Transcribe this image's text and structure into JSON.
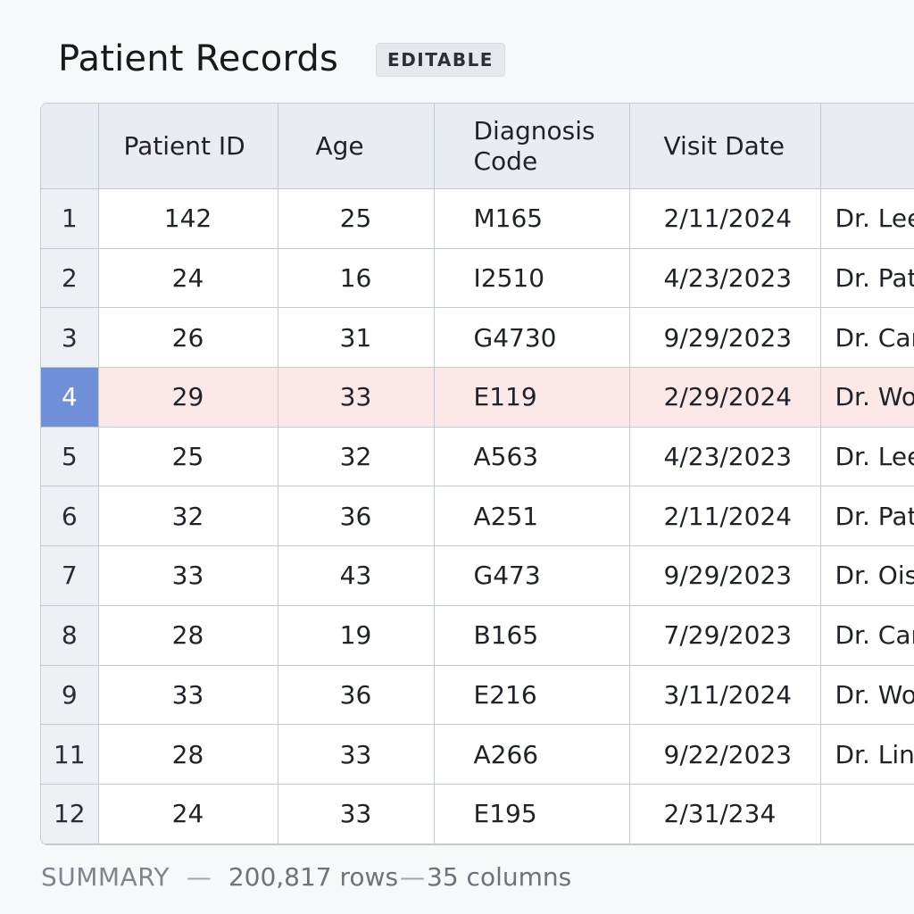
{
  "header": {
    "title": "Patient Records",
    "badge": "EDITABLE"
  },
  "columns": [
    "Patient ID",
    "Age",
    "Diagnosis Code",
    "Visit Date"
  ],
  "rows": [
    {
      "num": "1",
      "patient_id": "142",
      "age": "25",
      "diagnosis": "M165",
      "visit": "2/11/2024",
      "doctor": "Dr. Lee"
    },
    {
      "num": "2",
      "patient_id": "24",
      "age": "16",
      "diagnosis": "I2510",
      "visit": "4/23/2023",
      "doctor": "Dr. Pat"
    },
    {
      "num": "3",
      "patient_id": "26",
      "age": "31",
      "diagnosis": "G4730",
      "visit": "9/29/2023",
      "doctor": "Dr. Car"
    },
    {
      "num": "4",
      "patient_id": "29",
      "age": "33",
      "diagnosis": "E119",
      "visit": "2/29/2024",
      "doctor": "Dr. Wo"
    },
    {
      "num": "5",
      "patient_id": "25",
      "age": "32",
      "diagnosis": "A563",
      "visit": "4/23/2023",
      "doctor": "Dr. Lee"
    },
    {
      "num": "6",
      "patient_id": "32",
      "age": "36",
      "diagnosis": "A251",
      "visit": "2/11/2024",
      "doctor": "Dr. Pat"
    },
    {
      "num": "7",
      "patient_id": "33",
      "age": "43",
      "diagnosis": "G473",
      "visit": "9/29/2023",
      "doctor": "Dr. Ois"
    },
    {
      "num": "8",
      "patient_id": "28",
      "age": "19",
      "diagnosis": "B165",
      "visit": "7/29/2023",
      "doctor": "Dr. Car"
    },
    {
      "num": "9",
      "patient_id": "33",
      "age": "36",
      "diagnosis": "E216",
      "visit": "3/11/2024",
      "doctor": "Dr. Wo"
    },
    {
      "num": "11",
      "patient_id": "28",
      "age": "33",
      "diagnosis": "A266",
      "visit": "9/22/2023",
      "doctor": "Dr. Lin"
    },
    {
      "num": "12",
      "patient_id": "24",
      "age": "33",
      "diagnosis": "E195",
      "visit": "2/31/234",
      "doctor": ""
    }
  ],
  "selected_row": "4",
  "summary": {
    "label": "SUMMARY",
    "dash": "—",
    "rows": "200,817 rows",
    "dash2": "—",
    "columns": "35 columns"
  },
  "colors": {
    "selected_row_bg": "#fde8e8",
    "selected_rownum_bg": "#6f8fd8",
    "header_bg": "#e9edf2"
  }
}
